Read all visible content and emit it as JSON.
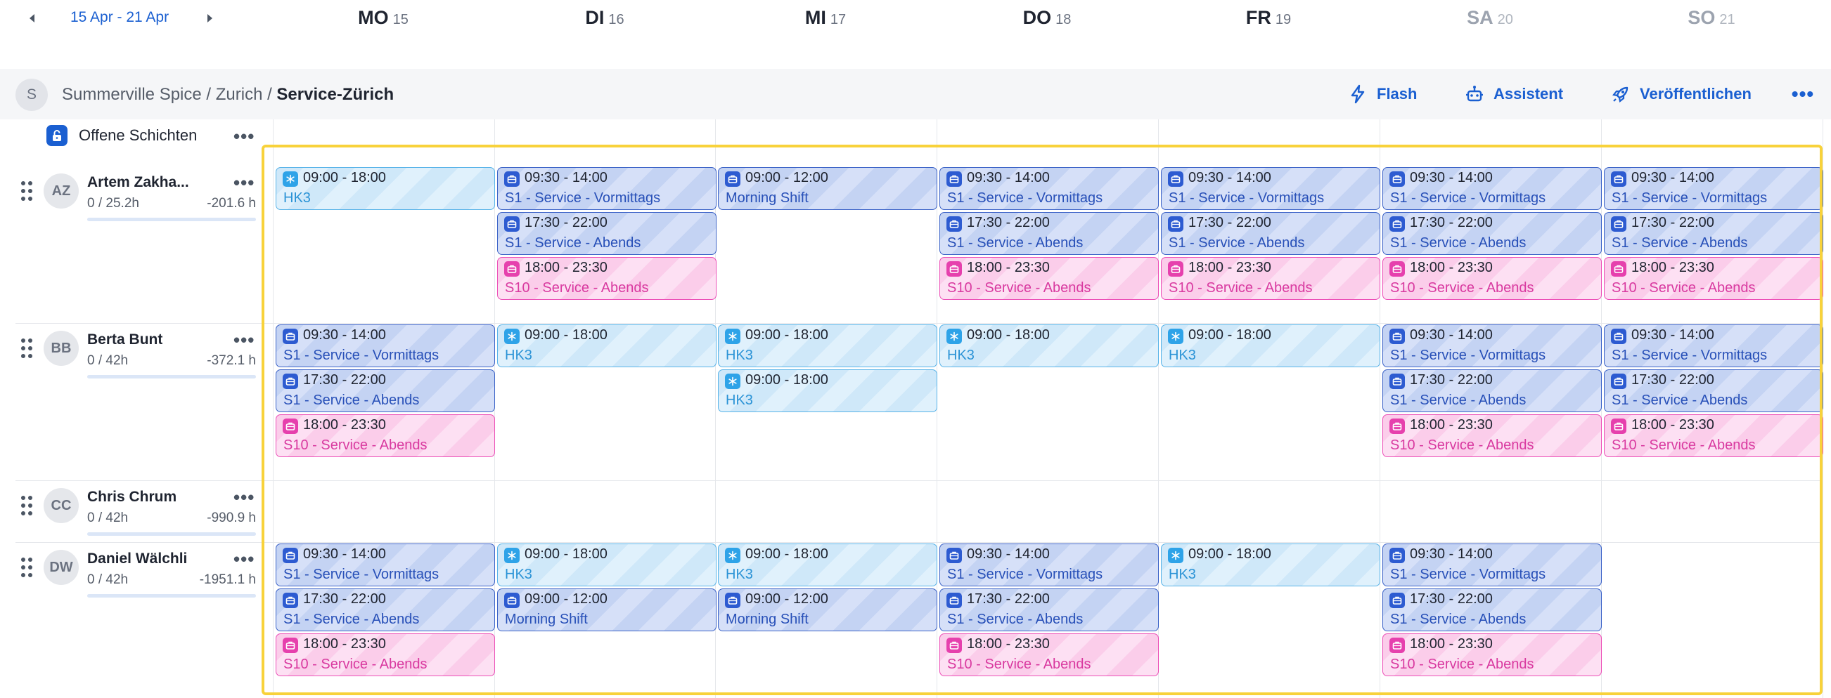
{
  "header": {
    "date_range": "15 Apr - 21 Apr",
    "prev_icon": "chevron-left-icon",
    "next_icon": "chevron-right-icon",
    "days": [
      {
        "name": "MO",
        "date": "15",
        "weekend": false
      },
      {
        "name": "DI",
        "date": "16",
        "weekend": false
      },
      {
        "name": "MI",
        "date": "17",
        "weekend": false
      },
      {
        "name": "DO",
        "date": "18",
        "weekend": false
      },
      {
        "name": "FR",
        "date": "19",
        "weekend": false
      },
      {
        "name": "SA",
        "date": "20",
        "weekend": true
      },
      {
        "name": "SO",
        "date": "21",
        "weekend": true
      }
    ]
  },
  "breadcrumb": {
    "avatar": "S",
    "path": "Summerville Spice / Zurich / ",
    "current": "Service-Zürich"
  },
  "actions": {
    "flash": {
      "label": "Flash",
      "icon": "lightning-icon"
    },
    "assistant": {
      "label": "Assistent",
      "icon": "robot-icon"
    },
    "publish": {
      "label": "Veröffentlichen",
      "icon": "rocket-icon"
    },
    "more": "•••"
  },
  "open_shifts": {
    "label": "Offene Schichten",
    "icon": "lock-icon",
    "more": "•••"
  },
  "colors": {
    "accent": "#1a5fd1",
    "blue_shift": "#3b62c7",
    "light_shift": "#58b3e8",
    "pink_shift": "#ec4fb7",
    "highlight": "#f8d23a"
  },
  "employees": [
    {
      "initials": "AZ",
      "name": "Artem Zakha...",
      "hours": "0 / 25.2h",
      "balance": "-201.6 h",
      "more": "•••",
      "days": [
        [
          {
            "time": "09:00 - 18:00",
            "name": "HK3",
            "type": "light"
          }
        ],
        [
          {
            "time": "09:30 - 14:00",
            "name": "S1 - Service - Vormittags",
            "type": "blue"
          },
          {
            "time": "17:30 - 22:00",
            "name": "S1 - Service - Abends",
            "type": "blue"
          },
          {
            "time": "18:00 - 23:30",
            "name": "S10 - Service - Abends",
            "type": "pink"
          }
        ],
        [
          {
            "time": "09:00 - 12:00",
            "name": "Morning Shift",
            "type": "blue"
          }
        ],
        [
          {
            "time": "09:30 - 14:00",
            "name": "S1 - Service - Vormittags",
            "type": "blue"
          },
          {
            "time": "17:30 - 22:00",
            "name": "S1 - Service - Abends",
            "type": "blue"
          },
          {
            "time": "18:00 - 23:30",
            "name": "S10 - Service - Abends",
            "type": "pink"
          }
        ],
        [
          {
            "time": "09:30 - 14:00",
            "name": "S1 - Service - Vormittags",
            "type": "blue"
          },
          {
            "time": "17:30 - 22:00",
            "name": "S1 - Service - Abends",
            "type": "blue"
          },
          {
            "time": "18:00 - 23:30",
            "name": "S10 - Service - Abends",
            "type": "pink"
          }
        ],
        [
          {
            "time": "09:30 - 14:00",
            "name": "S1 - Service - Vormittags",
            "type": "blue"
          },
          {
            "time": "17:30 - 22:00",
            "name": "S1 - Service - Abends",
            "type": "blue"
          },
          {
            "time": "18:00 - 23:30",
            "name": "S10 - Service - Abends",
            "type": "pink"
          }
        ],
        [
          {
            "time": "09:30 - 14:00",
            "name": "S1 - Service - Vormittags",
            "type": "blue"
          },
          {
            "time": "17:30 - 22:00",
            "name": "S1 - Service - Abends",
            "type": "blue"
          },
          {
            "time": "18:00 - 23:30",
            "name": "S10 - Service - Abends",
            "type": "pink"
          }
        ]
      ]
    },
    {
      "initials": "BB",
      "name": "Berta Bunt",
      "hours": "0 / 42h",
      "balance": "-372.1 h",
      "more": "•••",
      "days": [
        [
          {
            "time": "09:30 - 14:00",
            "name": "S1 - Service - Vormittags",
            "type": "blue"
          },
          {
            "time": "17:30 - 22:00",
            "name": "S1 - Service - Abends",
            "type": "blue"
          },
          {
            "time": "18:00 - 23:30",
            "name": "S10 - Service - Abends",
            "type": "pink"
          }
        ],
        [
          {
            "time": "09:00 - 18:00",
            "name": "HK3",
            "type": "light"
          }
        ],
        [
          {
            "time": "09:00 - 18:00",
            "name": "HK3",
            "type": "light"
          },
          {
            "time": "09:00 - 18:00",
            "name": "HK3",
            "type": "light"
          }
        ],
        [
          {
            "time": "09:00 - 18:00",
            "name": "HK3",
            "type": "light"
          }
        ],
        [
          {
            "time": "09:00 - 18:00",
            "name": "HK3",
            "type": "light"
          }
        ],
        [
          {
            "time": "09:30 - 14:00",
            "name": "S1 - Service - Vormittags",
            "type": "blue"
          },
          {
            "time": "17:30 - 22:00",
            "name": "S1 - Service - Abends",
            "type": "blue"
          },
          {
            "time": "18:00 - 23:30",
            "name": "S10 - Service - Abends",
            "type": "pink"
          }
        ],
        [
          {
            "time": "09:30 - 14:00",
            "name": "S1 - Service - Vormittags",
            "type": "blue"
          },
          {
            "time": "17:30 - 22:00",
            "name": "S1 - Service - Abends",
            "type": "blue"
          },
          {
            "time": "18:00 - 23:30",
            "name": "S10 - Service - Abends",
            "type": "pink"
          }
        ]
      ]
    },
    {
      "initials": "CC",
      "name": "Chris Chrum",
      "hours": "0 / 42h",
      "balance": "-990.9 h",
      "more": "•••",
      "days": [
        [],
        [],
        [],
        [],
        [],
        [],
        []
      ]
    },
    {
      "initials": "DW",
      "name": "Daniel Wälchli",
      "hours": "0 / 42h",
      "balance": "-1951.1 h",
      "more": "•••",
      "days": [
        [
          {
            "time": "09:30 - 14:00",
            "name": "S1 - Service - Vormittags",
            "type": "blue"
          },
          {
            "time": "17:30 - 22:00",
            "name": "S1 - Service - Abends",
            "type": "blue"
          },
          {
            "time": "18:00 - 23:30",
            "name": "S10 - Service - Abends",
            "type": "pink"
          }
        ],
        [
          {
            "time": "09:00 - 18:00",
            "name": "HK3",
            "type": "light"
          },
          {
            "time": "09:00 - 12:00",
            "name": "Morning Shift",
            "type": "blue"
          }
        ],
        [
          {
            "time": "09:00 - 18:00",
            "name": "HK3",
            "type": "light"
          },
          {
            "time": "09:00 - 12:00",
            "name": "Morning Shift",
            "type": "blue"
          }
        ],
        [
          {
            "time": "09:30 - 14:00",
            "name": "S1 - Service - Vormittags",
            "type": "blue"
          },
          {
            "time": "17:30 - 22:00",
            "name": "S1 - Service - Abends",
            "type": "blue"
          },
          {
            "time": "18:00 - 23:30",
            "name": "S10 - Service - Abends",
            "type": "pink"
          }
        ],
        [
          {
            "time": "09:00 - 18:00",
            "name": "HK3",
            "type": "light"
          }
        ],
        [
          {
            "time": "09:30 - 14:00",
            "name": "S1 - Service - Vormittags",
            "type": "blue"
          },
          {
            "time": "17:30 - 22:00",
            "name": "S1 - Service - Abends",
            "type": "blue"
          },
          {
            "time": "18:00 - 23:30",
            "name": "S10 - Service - Abends",
            "type": "pink"
          }
        ],
        []
      ]
    }
  ]
}
